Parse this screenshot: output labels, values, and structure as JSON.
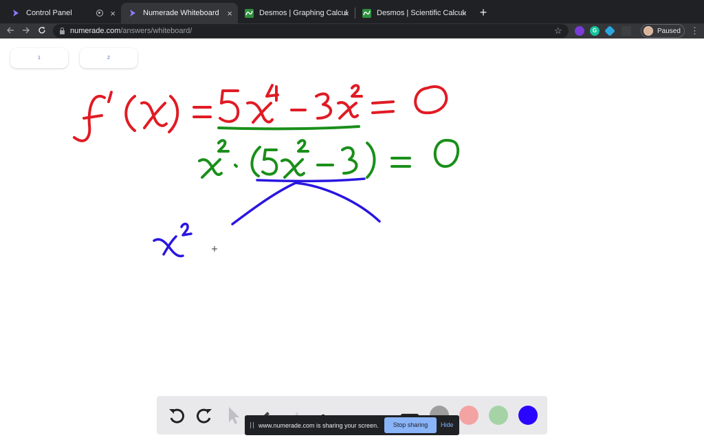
{
  "browser": {
    "tabs": [
      {
        "label": "Control Panel",
        "icon": "numerade-logo-icon",
        "recording": true
      },
      {
        "label": "Numerade Whiteboard",
        "icon": "numerade-logo-icon",
        "active": true
      },
      {
        "label": "Desmos | Graphing Calculator",
        "icon": "desmos-logo-icon"
      },
      {
        "label": "Desmos | Scientific Calculator",
        "icon": "desmos-logo-icon"
      }
    ],
    "close_glyph": "×",
    "new_tab_glyph": "+",
    "url_host": "numerade.com",
    "url_path": "/answers/whiteboard/",
    "profile_status": "Paused",
    "extension_g_label": "G"
  },
  "pages": {
    "items": [
      "1",
      "2"
    ]
  },
  "whiteboard": {
    "ink_colors": {
      "red": "#e01b24",
      "green": "#1a8f1a",
      "blue": "#2a16e0"
    },
    "cursor_icon": "crosshair-icon"
  },
  "toolbar": {
    "tools": [
      "undo-icon",
      "redo-icon",
      "pointer-icon",
      "pen-icon",
      "highlighter-icon",
      "add-icon",
      "eraser-icon",
      "shape-icon",
      "image-icon"
    ],
    "swatches": [
      "#9e9e9e",
      "#f4a3a3",
      "#a6d3a6",
      "#2b06ff"
    ],
    "selected_swatch": "#2b06ff"
  },
  "screen_share": {
    "message": "www.numerade.com is sharing your screen.",
    "stop_label": "Stop sharing",
    "hide_label": "Hide"
  }
}
